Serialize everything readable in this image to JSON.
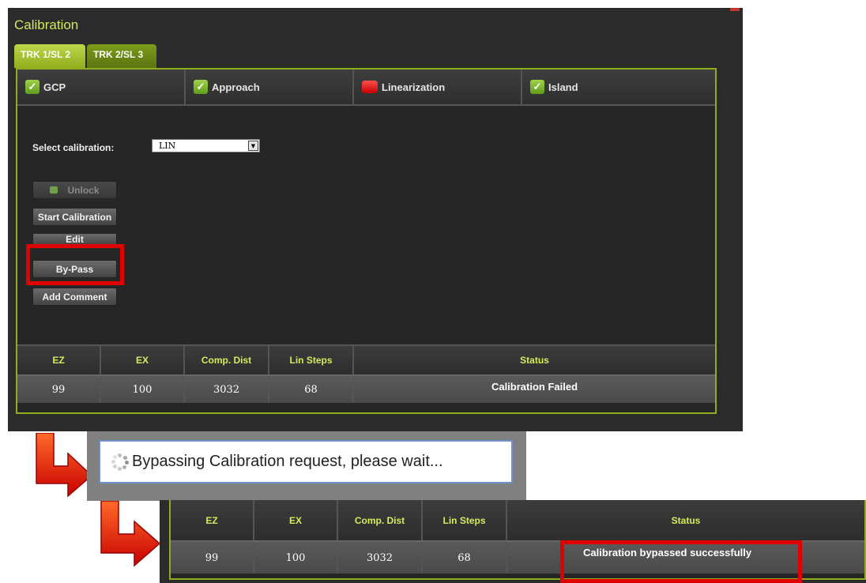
{
  "panel": {
    "title": "Calibration",
    "tabs": [
      "TRK 1/SL 2",
      "TRK 2/SL 3"
    ],
    "calibrations": [
      {
        "label": "GCP",
        "status": "ok"
      },
      {
        "label": "Approach",
        "status": "ok"
      },
      {
        "label": "Linearization",
        "status": "fail"
      },
      {
        "label": "Island",
        "status": "ok"
      }
    ],
    "select_label": "Select calibration:",
    "select_value": "LIN",
    "buttons": {
      "unlock": "Unlock",
      "start": "Start Calibration",
      "edit": "Edit",
      "bypass": "By-Pass",
      "comment": "Add Comment"
    }
  },
  "table": {
    "headers": [
      "EZ",
      "EX",
      "Comp. Dist",
      "Lin Steps",
      "Status"
    ],
    "before": [
      "99",
      "100",
      "3032",
      "68",
      "Calibration Failed"
    ],
    "after": [
      "99",
      "100",
      "3032",
      "68",
      "Calibration bypassed successfully"
    ]
  },
  "toast": {
    "message": "Bypassing Calibration request, please wait..."
  },
  "colors": {
    "accent": "#8fae1c",
    "highlight": "#e00000",
    "arrow": "#e02000"
  }
}
